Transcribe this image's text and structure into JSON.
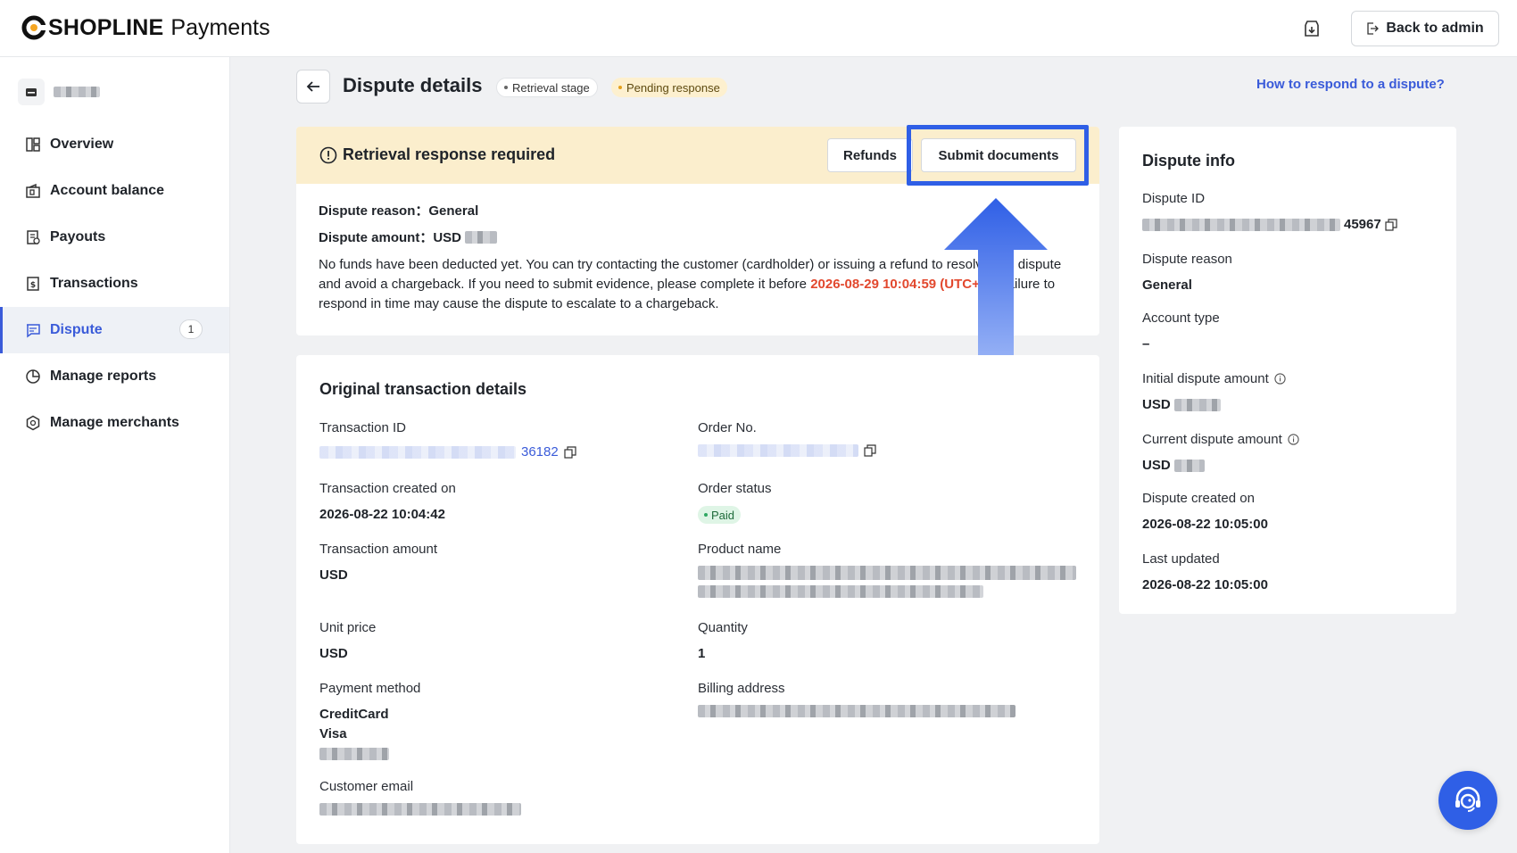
{
  "header": {
    "brand": "SHOPLINE",
    "product": "Payments",
    "back_to_admin": "Back to admin",
    "icons": {
      "logo": "shopline-logo-icon",
      "download": "download-icon",
      "exit": "exit-icon"
    }
  },
  "sidebar": {
    "items": [
      {
        "label": "Overview",
        "icon": "overview-icon"
      },
      {
        "label": "Account balance",
        "icon": "wallet-icon"
      },
      {
        "label": "Payouts",
        "icon": "payout-icon"
      },
      {
        "label": "Transactions",
        "icon": "transactions-icon"
      },
      {
        "label": "Dispute",
        "icon": "dispute-icon",
        "active": true,
        "badge": "1"
      },
      {
        "label": "Manage reports",
        "icon": "pie-chart-icon"
      },
      {
        "label": "Manage merchants",
        "icon": "merchant-icon"
      }
    ]
  },
  "page": {
    "title": "Dispute details",
    "stage_tag": "Retrieval stage",
    "status_tag": "Pending response",
    "help_link": "How to respond to a dispute?"
  },
  "alert": {
    "title": "Retrieval response required",
    "refunds_button": "Refunds",
    "submit_button": "Submit documents",
    "reason_label": "Dispute reason：",
    "reason_value": "General",
    "amount_label": "Dispute amount：",
    "amount_currency": "USD",
    "text_part1": "No funds have been deducted yet. You can try contacting the customer (cardholder) or issuing a refund to resolve this dispute and avoid a chargeback. If you need to submit evidence, please complete it before ",
    "deadline": "2026-08-29 10:04:59 (UTC+8)",
    "text_part2": ". Failure to respond in time may cause the dispute to escalate to a chargeback."
  },
  "transaction": {
    "section_title": "Original transaction details",
    "txn_id_label": "Transaction ID",
    "txn_id_suffix": "36182",
    "order_no_label": "Order No.",
    "created_label": "Transaction created on",
    "created_value": "2026-08-22 10:04:42",
    "order_status_label": "Order status",
    "order_status_value": "Paid",
    "amount_label": "Transaction amount",
    "amount_currency": "USD",
    "product_label": "Product name",
    "unit_price_label": "Unit price",
    "unit_price_currency": "USD",
    "quantity_label": "Quantity",
    "quantity_value": "1",
    "payment_method_label": "Payment method",
    "payment_method_value": "CreditCard",
    "card_brand": "Visa",
    "billing_label": "Billing address",
    "email_label": "Customer email"
  },
  "info": {
    "title": "Dispute info",
    "id_label": "Dispute ID",
    "id_suffix": "45967",
    "reason_label": "Dispute reason",
    "reason_value": "General",
    "account_type_label": "Account type",
    "account_type_value": "–",
    "initial_amount_label": "Initial dispute amount",
    "initial_currency": "USD",
    "current_amount_label": "Current dispute amount",
    "current_currency": "USD",
    "created_label": "Dispute created on",
    "created_value": "2026-08-22 10:05:00",
    "updated_label": "Last updated",
    "updated_value": "2026-08-22 10:05:00"
  },
  "colors": {
    "accent": "#3a5bd9",
    "highlight": "#2f5fe6",
    "alert_bg": "#fbeecd",
    "deadline": "#e2482e"
  }
}
